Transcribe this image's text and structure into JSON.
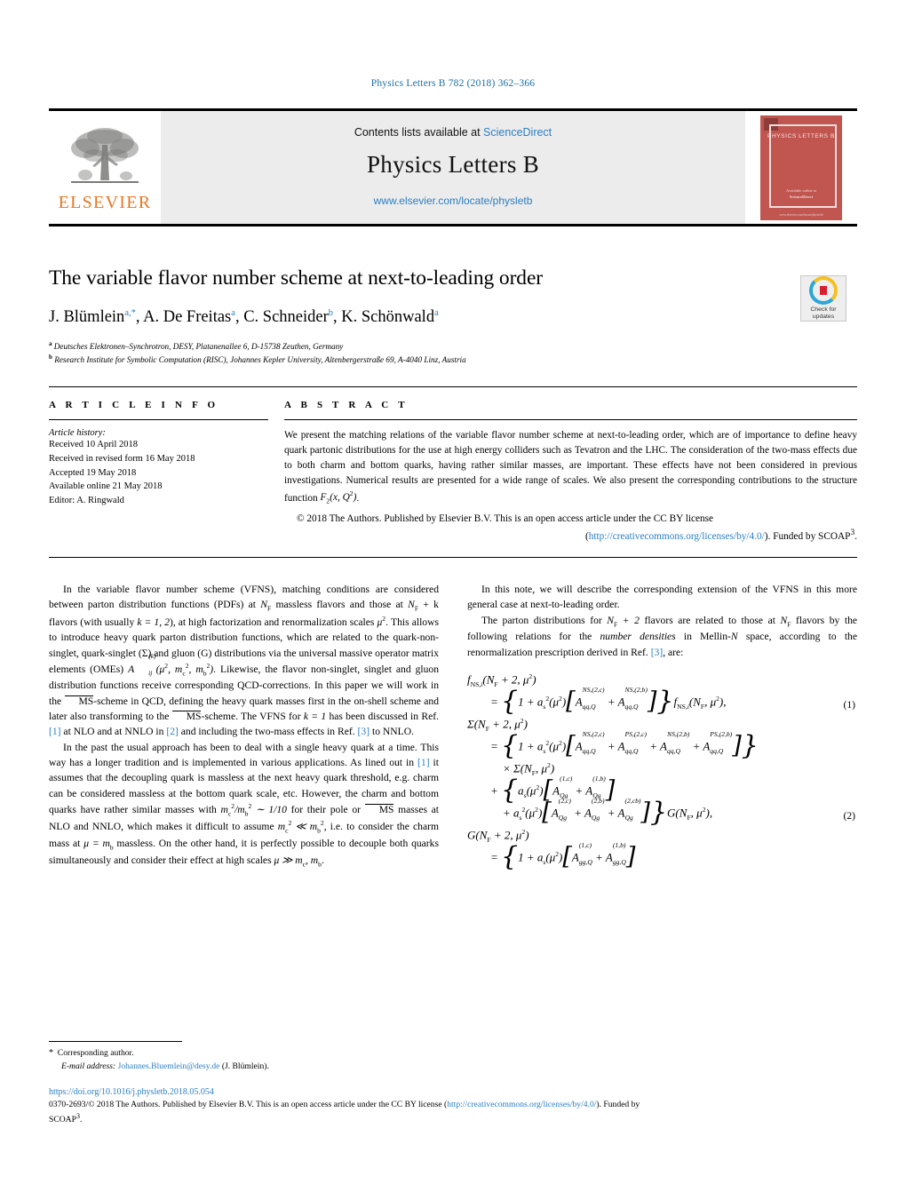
{
  "running_head": "Physics Letters B 782 (2018) 362–366",
  "masthead": {
    "contents_prefix": "Contents lists available at ",
    "sciencedirect": "ScienceDirect",
    "journal_name": "Physics Letters B",
    "journal_url": "www.elsevier.com/locate/physletb",
    "publisher_logo_text": "ELSEVIER",
    "cover": {
      "title": "PHYSICS LETTERS B",
      "footer_line1": "Available online at",
      "footer_line2": "ScienceDirect",
      "bottom_bar": "www.elsevier.com/locate/physletb"
    }
  },
  "article": {
    "title": "The variable flavor number scheme at next-to-leading order",
    "authors": "J. Blümlein, A. De Freitas, C. Schneider, K. Schönwald",
    "author_list": [
      {
        "name": "J. Blümlein",
        "marks": "a,*"
      },
      {
        "name": "A. De Freitas",
        "marks": "a"
      },
      {
        "name": "C. Schneider",
        "marks": "b"
      },
      {
        "name": "K. Schönwald",
        "marks": "a"
      }
    ],
    "affiliations": [
      {
        "mark": "a",
        "text": "Deutsches Elektronen–Synchrotron, DESY, Platanenallee 6, D-15738 Zeuthen, Germany"
      },
      {
        "mark": "b",
        "text": "Research Institute for Symbolic Computation (RISC), Johannes Kepler University, Altenbergerstraße 69, A-4040 Linz, Austria"
      }
    ],
    "crossmark": {
      "line1": "Check for",
      "line2": "updates"
    }
  },
  "info": {
    "heading": "A R T I C L E   I N F O",
    "history_label": "Article history:",
    "history": [
      "Received 10 April 2018",
      "Received in revised form 16 May 2018",
      "Accepted 19 May 2018",
      "Available online 21 May 2018",
      "Editor: A. Ringwald"
    ]
  },
  "abstract": {
    "heading": "A B S T R A C T",
    "text_part1": "We present the matching relations of the variable flavor number scheme at next-to-leading order, which are of importance to define heavy quark partonic distributions for the use at high energy colliders such as Tevatron and the LHC. The consideration of the two-mass effects due to both charm and bottom quarks, having rather similar masses, are important. These effects have not been considered in previous investigations. Numerical results are presented for a wide range of scales. We also present the corresponding contributions to the structure function ",
    "text_formula": "F2(x, Q 2)",
    "text_part2": ".",
    "copyright_lead": "© 2018 The Authors. Published by Elsevier B.V. This is an open access article under the CC BY license",
    "license_open": "(",
    "license_url": "http://creativecommons.org/licenses/by/4.0/",
    "license_close": "). Funded by SCOAP",
    "license_sup": "3",
    "license_end": "."
  },
  "body": {
    "left": {
      "p1_a": "In the variable flavor number scheme (VFNS), matching conditions are considered between parton distribution functions (PDFs) at ",
      "p1_nf": "N",
      "p1_nf_sub": "F",
      "p1_b": " massless flavors and those at ",
      "p1_nfk": "N",
      "p1_nfk_sub": "F",
      "p1_c": " + k flavors (with usually ",
      "p1_k": "k = 1, 2",
      "p1_d": "), at high factorization and renormalization scales ",
      "p1_mu": "μ",
      "p1_mu_sup": "2",
      "p1_e": ". This allows to introduce heavy quark parton distribution functions, which are related to the quark-non-singlet, quark-singlet (Σ) and gluon (G) distributions via the universal massive operator matrix elements (OMEs) ",
      "p1_ome": "A",
      "p1_f": ". Likewise, the flavor non-singlet, singlet and gluon distribution functions receive corresponding QCD-corrections. In this paper we will work in the ",
      "p1_msbar": "MS",
      "p1_g": "-scheme in QCD, defining the heavy quark masses first in the on-shell scheme and later also transforming to the ",
      "p1_h": "-scheme. The VFNS for ",
      "p1_k1": "k = 1",
      "p1_i": " has been discussed in Ref. ",
      "p1_ref1": "[1]",
      "p1_j": " at NLO and at NNLO in ",
      "p1_ref2": "[2]",
      "p1_k_txt": " and including the two-mass effects in Ref. ",
      "p1_ref3": "[3]",
      "p1_l": " to NNLO.",
      "p2_a": "In the past the usual approach has been to deal with a single heavy quark at a time. This way has a longer tradition and is implemented in various applications. As lined out in ",
      "p2_ref1": "[1]",
      "p2_b": " it assumes that the decoupling quark is massless at the next heavy quark threshold, e.g. charm can be considered massless at the bottom quark scale, etc. However, the charm and bottom quarks have rather similar masses with ",
      "p2_ratio": "m2c /m2b ~ 1/10",
      "p2_c": " for their pole or ",
      "p2_msbar": "MS",
      "p2_d": " masses at NLO and NNLO, which makes it difficult to assume ",
      "p2_ineq": "m2c ≪ m2b",
      "p2_e": ", i.e. to consider the charm mass at ",
      "p2_mu": "μ = mb",
      "p2_f": " massless. On the other hand, it is perfectly possible to decouple both quarks simultaneously and consider their effect at high scales ",
      "p2_scales": "μ ≫ mc, mb",
      "p2_g": "."
    },
    "right": {
      "p1": "In this note, we will describe the corresponding extension of the VFNS in this more general case at next-to-leading order.",
      "p2_a": "The parton distributions for ",
      "p2_nf2": "NF + 2",
      "p2_b": " flavors are related to those at ",
      "p2_nf": "NF",
      "p2_c": " flavors by the following relations for the ",
      "p2_italic": "number densities",
      "p2_d": " in Mellin-",
      "p2_N": "N",
      "p2_e": " space, according to the renormalization prescription derived in Ref. ",
      "p2_ref": "[3]",
      "p2_f": ", are:"
    }
  },
  "equations": {
    "eq1_number": "(1)",
    "eq2_number": "(2)",
    "eq1_lhs": "fNS,i(NF + 2, μ2)",
    "eq1_rhs": "= {1 + as2(μ2)[AqqNS,(2,c),Q + AqqNS,(2,b),Q]} fNS,i(NF, μ2),",
    "eq2_lhs": "Σ(NF + 2, μ2)",
    "eq3_lhs": "G(NF + 2, μ2)"
  },
  "footnotes": {
    "corresponding": "Corresponding author.",
    "email_label": "E-mail address:",
    "email": "Johannes.Bluemlein@desy.de",
    "email_owner": "(J. Blümlein)."
  },
  "footer": {
    "doi": "https://doi.org/10.1016/j.physletb.2018.05.054",
    "issn_line": "0370-2693/© 2018 The Authors. Published by Elsevier B.V. This is an open access article under the CC BY license (",
    "license_url": "http://creativecommons.org/licenses/by/4.0/",
    "issn_tail": "). Funded by",
    "scoap_line": "SCOAP",
    "scoap_sup": "3",
    "scoap_end": "."
  },
  "colors": {
    "link": "#2b7fc4",
    "elsevier_orange": "#E87722",
    "cover_red": "#c0564f",
    "masthead_gray": "#ececec"
  }
}
